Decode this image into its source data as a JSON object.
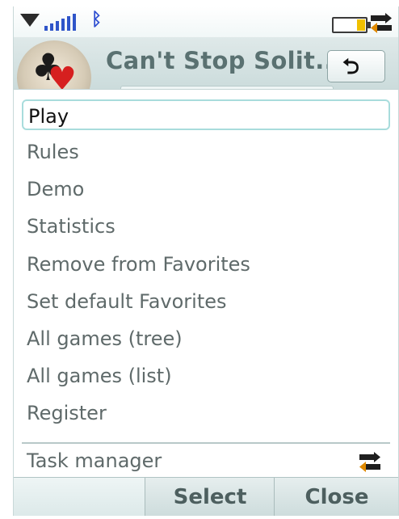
{
  "status_bar": {
    "signal_icon": "signal-strength-icon",
    "bluetooth_icon": "bluetooth-icon",
    "battery_icon": "battery-icon",
    "task_icon": "task-switch-icon"
  },
  "title_bar": {
    "app_icon": "cards-suit-icon",
    "title": "Can't Stop Solit...",
    "back_icon": "back-arrow-icon",
    "back_symbol": "⮌"
  },
  "menu": {
    "items": [
      {
        "label": "Play",
        "selected": true
      },
      {
        "label": "Rules",
        "selected": false
      },
      {
        "label": "Demo",
        "selected": false
      },
      {
        "label": "Statistics",
        "selected": false
      },
      {
        "label": "Remove from Favorites",
        "selected": false
      },
      {
        "label": "Set default Favorites",
        "selected": false
      },
      {
        "label": "All games (tree)",
        "selected": false
      },
      {
        "label": "All games (list)",
        "selected": false
      },
      {
        "label": "Register",
        "selected": false
      }
    ],
    "task_manager_label": "Task manager",
    "task_manager_icon": "task-switch-icon"
  },
  "softkeys": {
    "left": "",
    "select": "Select",
    "close": "Close"
  },
  "colors": {
    "accent": "#a8dcdc",
    "titlebar": "#c9dada",
    "softkey": "#cddcdc",
    "text": "#5f6a6a"
  }
}
